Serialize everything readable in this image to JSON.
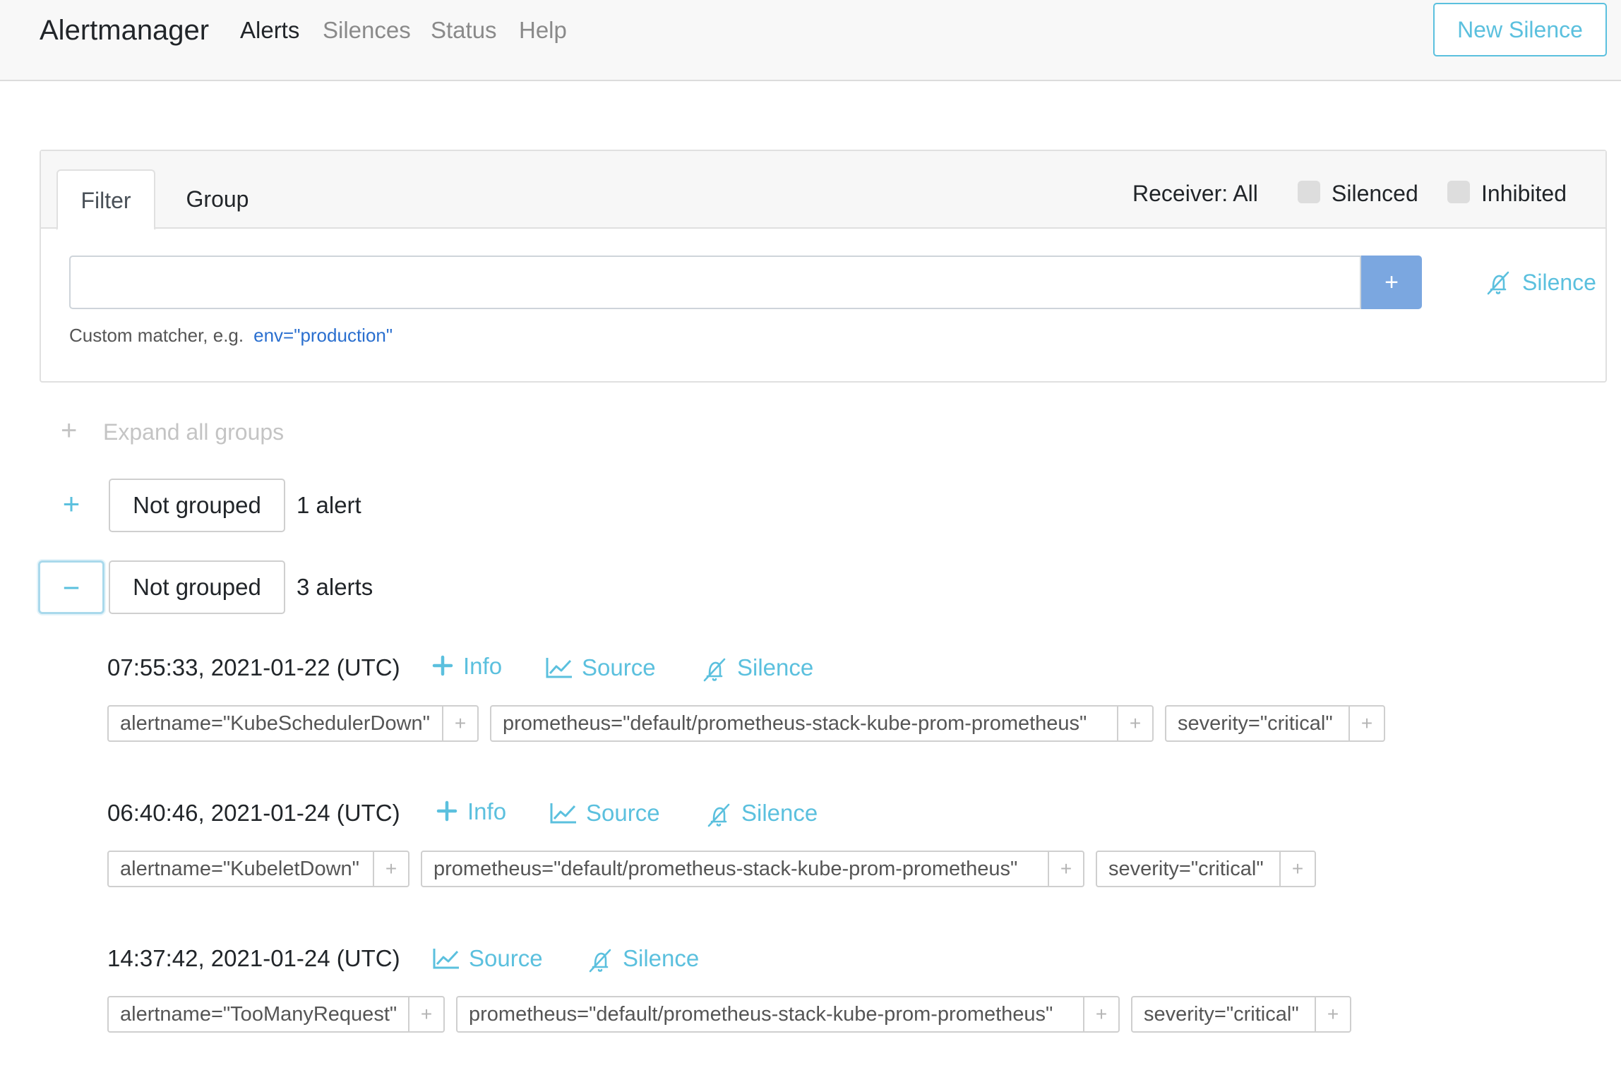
{
  "navbar": {
    "brand": "Alertmanager",
    "items": [
      {
        "label": "Alerts",
        "active": true
      },
      {
        "label": "Silences",
        "active": false
      },
      {
        "label": "Status",
        "active": false
      },
      {
        "label": "Help",
        "active": false
      }
    ],
    "new_silence_label": "New Silence"
  },
  "filter_card": {
    "tabs": [
      {
        "label": "Filter",
        "active": true
      },
      {
        "label": "Group",
        "active": false
      }
    ],
    "receiver_label": "Receiver: All",
    "silenced_label": "Silenced",
    "inhibited_label": "Inhibited",
    "input_value": "",
    "input_placeholder": "",
    "add_label": "+",
    "silence_label": "Silence",
    "hint_text": "Custom matcher, e.g.",
    "hint_example": "env=\"production\""
  },
  "expand_all_label": "Expand all groups",
  "groups": [
    {
      "toggle": "+",
      "label": "Not grouped",
      "count": "1 alert",
      "expanded": false
    },
    {
      "toggle": "−",
      "label": "Not grouped",
      "count": "3 alerts",
      "expanded": true
    }
  ],
  "alerts": [
    {
      "time": "07:55:33, 2021-01-22 (UTC)",
      "info_label": "Info",
      "source_label": "Source",
      "silence_label": "Silence",
      "labels": [
        "alertname=\"KubeSchedulerDown\"",
        "prometheus=\"default/prometheus-stack-kube-prom-prometheus\"",
        "severity=\"critical\""
      ]
    },
    {
      "time": "06:40:46, 2021-01-24 (UTC)",
      "info_label": "Info",
      "source_label": "Source",
      "silence_label": "Silence",
      "labels": [
        "alertname=\"KubeletDown\"",
        "prometheus=\"default/prometheus-stack-kube-prom-prometheus\"",
        "severity=\"critical\""
      ]
    },
    {
      "time": "14:37:42, 2021-01-24 (UTC)",
      "source_label": "Source",
      "silence_label": "Silence",
      "labels": [
        "alertname=\"TooManyRequest\"",
        "prometheus=\"default/prometheus-stack-kube-prom-prometheus\"",
        "severity=\"critical\""
      ]
    }
  ],
  "label_add_symbol": "+",
  "colors": {
    "accent": "#5bc0de",
    "primary_button": "#7ba7e0",
    "navbar_bg": "#f8f8f8",
    "link": "#2a6fcf"
  }
}
